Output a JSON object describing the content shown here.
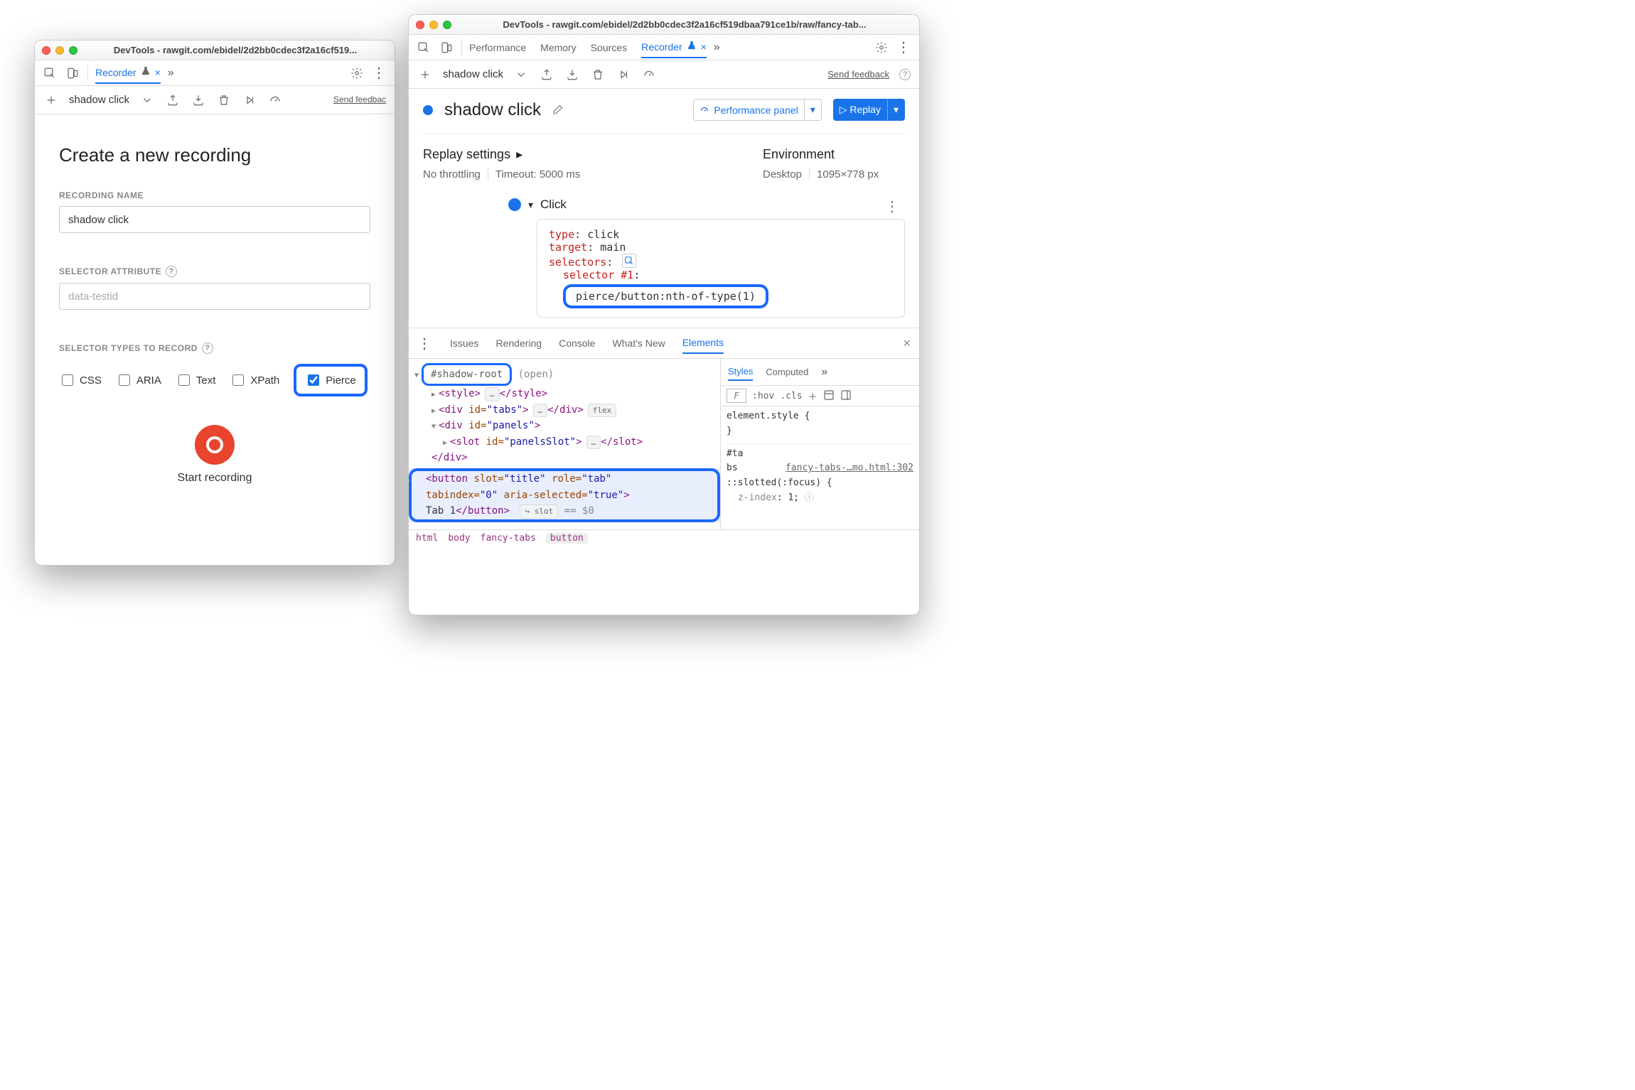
{
  "left": {
    "title": "DevTools - rawgit.com/ebidel/2d2bb0cdec3f2a16cf519...",
    "active_tab": "Recorder",
    "recording_dropdown": "shadow click",
    "send_feedback": "Send feedbac",
    "h1": "Create a new recording",
    "field_name_label": "RECORDING NAME",
    "field_name_value": "shadow click",
    "field_attr_label": "SELECTOR ATTRIBUTE",
    "field_attr_placeholder": "data-testid",
    "sel_types_label": "SELECTOR TYPES TO RECORD",
    "checks": {
      "css": "CSS",
      "aria": "ARIA",
      "text": "Text",
      "xpath": "XPath",
      "pierce": "Pierce"
    },
    "start_label": "Start recording"
  },
  "right": {
    "title": "DevTools - rawgit.com/ebidel/2d2bb0cdec3f2a16cf519dbaa791ce1b/raw/fancy-tab...",
    "top_tabs": [
      "Performance",
      "Memory",
      "Sources",
      "Recorder"
    ],
    "recording_dropdown": "shadow click",
    "send_feedback": "Send feedback",
    "rec_name": "shadow click",
    "perf_panel": "Performance panel",
    "replay": "Replay",
    "replay_settings": "Replay settings",
    "environment": "Environment",
    "throttling": "No throttling",
    "timeout": "Timeout: 5000 ms",
    "device": "Desktop",
    "viewport": "1095×778 px",
    "step_name": "Click",
    "step": {
      "type_k": "type",
      "type_v": "click",
      "target_k": "target",
      "target_v": "main",
      "selectors_k": "selectors",
      "sel_label": "selector #1",
      "sel_value": "pierce/button:nth-of-type(1)"
    },
    "drawer_tabs": [
      "Issues",
      "Rendering",
      "Console",
      "What's New",
      "Elements"
    ],
    "shadow_root": "#shadow-root",
    "shadow_open": "(open)",
    "tree": {
      "style_open": "<style>",
      "style_close": "</style>",
      "div_tabs_open": "<div id=\"tabs\">",
      "div_close": "</div>",
      "flex": "flex",
      "div_panels_open": "<div id=\"panels\">",
      "slot_panels": "<slot id=\"panelsSlot\">",
      "slot_close": "</slot>",
      "button_sel": "<button slot=\"title\" role=\"tab\" tabindex=\"0\" aria-selected=\"true\">Tab 1</button>",
      "eqdollar": "== $0",
      "slot_badge": "slot"
    },
    "crumbs": [
      "html",
      "body",
      "fancy-tabs",
      "button"
    ],
    "styles_tabs": [
      "Styles",
      "Computed"
    ],
    "filter_placeholder": "F",
    "hov": ":hov",
    "cls": ".cls",
    "element_style": "element.style {",
    "rule_sel": "#ta\nbs",
    "rule_src": "fancy-tabs-…mo.html:302",
    "slotted": "::slotted(:focus) {",
    "zindex": "z-index",
    "zindex_v": "1"
  }
}
